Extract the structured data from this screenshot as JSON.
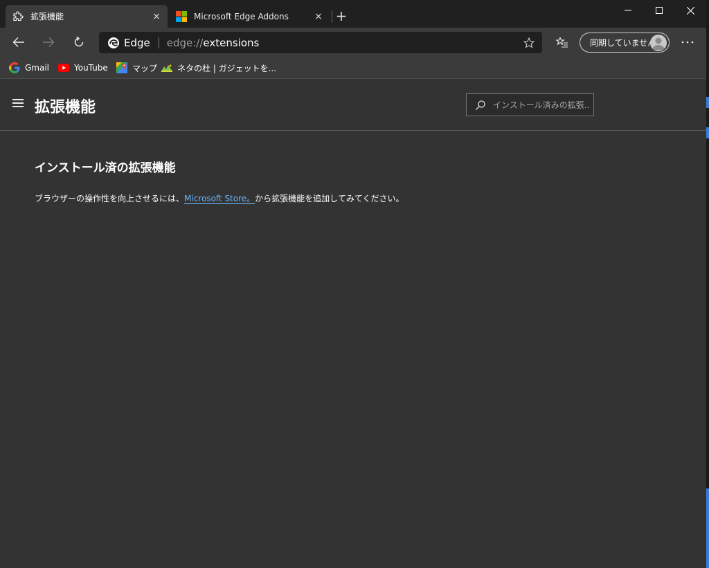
{
  "window": {
    "tabs": [
      {
        "title": "拡張機能",
        "icon": "puzzle-icon",
        "active": true
      },
      {
        "title": "Microsoft Edge Addons",
        "icon": "microsoft-logo-icon",
        "active": false
      }
    ],
    "new_tab_label": "+",
    "close_glyph": "×",
    "controls": {
      "minimize": "minimize-icon",
      "maximize": "maximize-icon",
      "close": "close-icon"
    }
  },
  "toolbar": {
    "omnibox": {
      "site_label": "Edge",
      "url_scheme": "edge://",
      "url_path": "extensions"
    },
    "sync_button_label": "同期していません"
  },
  "bookmarks": [
    {
      "label": "Gmail",
      "icon": "google-icon"
    },
    {
      "label": "YouTube",
      "icon": "youtube-icon"
    },
    {
      "label": "マップ",
      "icon": "maps-icon"
    },
    {
      "label": "ネタの杜 | ガジェットを...",
      "icon": "site-icon"
    }
  ],
  "page": {
    "title": "拡張機能",
    "search_placeholder": "インストール済みの拡張...",
    "installed_heading": "インストール済の拡張機能",
    "description_before": "ブラウザーの操作性を向上させるには、",
    "description_link": "Microsoft Store。",
    "description_after": "から拡張機能を追加してみてください。"
  },
  "colors": {
    "background": "#333333",
    "titlebar": "#202020",
    "toolbar": "#3b3b3b",
    "link": "#6cb4f5"
  }
}
